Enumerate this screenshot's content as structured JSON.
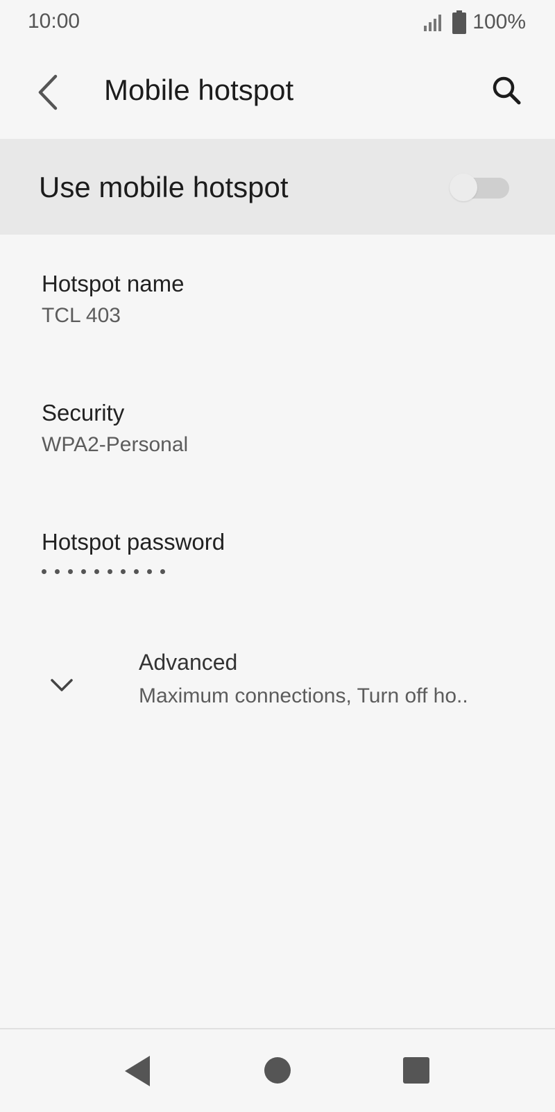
{
  "status_bar": {
    "time": "10:00",
    "battery_percent": "100%",
    "icons": [
      "signal-icon",
      "battery-icon"
    ]
  },
  "toolbar": {
    "title": "Mobile hotspot",
    "icons": [
      "back-arrow-icon",
      "search-icon"
    ]
  },
  "master_switch": {
    "label": "Use mobile hotspot",
    "enabled": false
  },
  "preferences": {
    "hotspot_name": {
      "title": "Hotspot name",
      "summary": "TCL 403"
    },
    "security": {
      "title": "Security",
      "summary": "WPA2-Personal"
    },
    "password": {
      "title": "Hotspot password",
      "masked_length": 10
    },
    "advanced": {
      "title": "Advanced",
      "summary": "Maximum connections, Turn off ho..",
      "icon": "chevron-down-icon"
    }
  },
  "nav_bar": {
    "icons": [
      "nav-back-icon",
      "nav-home-icon",
      "nav-recents-icon"
    ]
  },
  "colors": {
    "background": "#f6f6f6",
    "highlight_row": "#e8e8e8",
    "toggle_track_off": "#cfcfcf",
    "toggle_thumb_off": "#ececec",
    "icon_grey": "#555555"
  }
}
